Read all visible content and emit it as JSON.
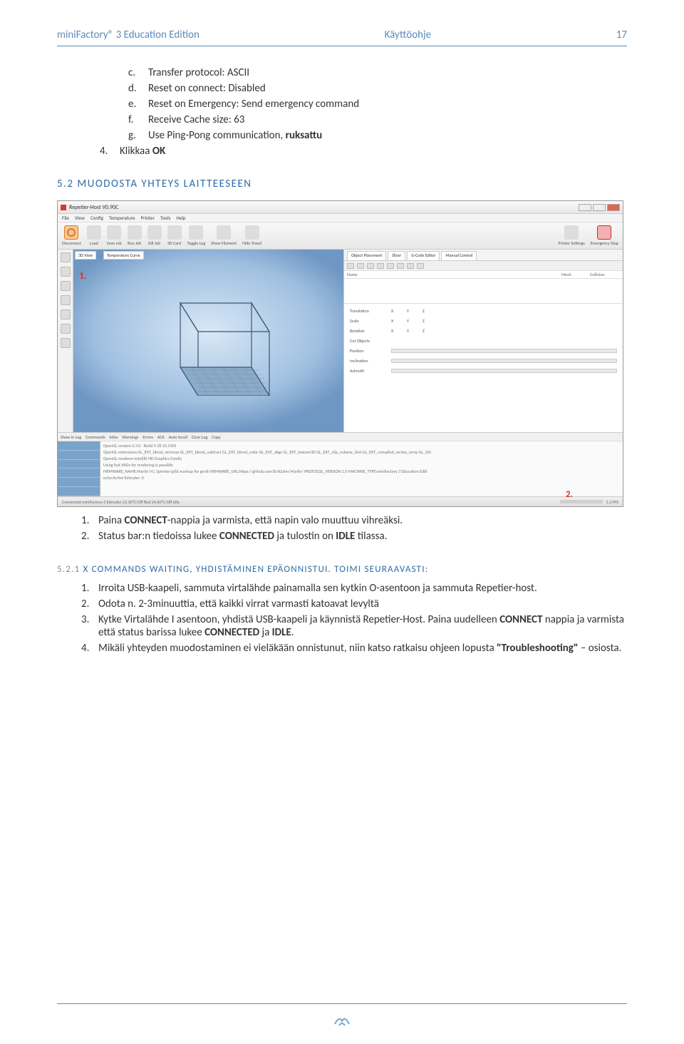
{
  "header": {
    "left": "miniFactory® 3 Education Edition",
    "center": "Käyttöohje",
    "right": "17"
  },
  "settings_list": {
    "c": {
      "label": "c.",
      "text": "Transfer protocol: ASCII"
    },
    "d": {
      "label": "d.",
      "text": "Reset on connect: Disabled"
    },
    "e": {
      "label": "e.",
      "text": "Reset on Emergency: Send emergency command"
    },
    "f": {
      "label": "f.",
      "text": "Receive Cache size: 63"
    },
    "g": {
      "label": "g.",
      "text_pre": "Use Ping-Pong communication, ",
      "text_bold": "ruksattu"
    },
    "item4": {
      "label": "4.",
      "text_pre": "Klikkaa ",
      "text_bold": "OK"
    }
  },
  "section52_title": "5.2 MUODOSTA YHTEYS LAITTEESEEN",
  "screenshot": {
    "title": "Repetier-Host V0.90C",
    "menu": [
      "File",
      "View",
      "Config",
      "Temperature",
      "Printer",
      "Tools",
      "Help"
    ],
    "toolbar_left": [
      "Disconnect",
      "Load",
      "Save Job",
      "Run Job",
      "Kill Job",
      "SD Card",
      "Toggle Log",
      "Show Filament",
      "Hide Travel"
    ],
    "toolbar_right": [
      "Printer Settings",
      "Emergency Stop"
    ],
    "left_tab": "3D View",
    "temp_tab": "Temperature Curve",
    "marker1": "1.",
    "right_tabs": [
      "Object Placement",
      "Slicer",
      "G-Code Editor",
      "Manual Control"
    ],
    "table_head": [
      "Name",
      "Mesh",
      "Collision"
    ],
    "props": {
      "translation": "Translation",
      "scale": "Scale",
      "rotation": "Rotation",
      "cut": "Cut Objects",
      "position": "Position",
      "inclination": "Inclination",
      "azimuth": "Azimuth",
      "x": "X",
      "y": "Y",
      "z": "Z"
    },
    "logbar": [
      "Show in Log",
      "Commands",
      "Infos",
      "Warnings",
      "Errors",
      "ACK",
      "Auto Scroll",
      "Clear Log",
      "Copy"
    ],
    "log_lines": [
      "OpenGL version:3.3.0 - Build 9.18.10.3165",
      "OpenGL extensions:GL_EXT_blend_minmax GL_EXT_blend_subtract GL_EXT_blend_color GL_EXT_abgr GL_EXT_texture3D GL_EXT_clip_volume_hint GL_EXT_compiled_vertex_array GL_SGI",
      "OpenGL renderer:Intel(R) HD Graphics Family",
      "Using fast VAOs for rendering is possible",
      "FIRMWARE_NAME:Marlin V1; Sprinter/grbl mashup for gen6 FIRMWARE_URL:https://github.com/ErikZalm/Marlin/ PROTOCOL_VERSION:1.0 MACHINE_TYPE:miniFactory 3 Education Editi",
      "echo:Active Extruder: 0"
    ],
    "marker2": "2.",
    "status_left": "Connected:miniFactory-3  Extruder 22.30°C/Off Bed 24.60°C/Off  Idle",
    "status_fps": "1.2 FPS"
  },
  "after_ss_list": {
    "1": {
      "n": "1.",
      "pre": "Paina ",
      "b1": "CONNECT",
      "mid": "-nappia ja varmista, että napin valo muuttuu vihreäksi."
    },
    "2": {
      "n": "2.",
      "pre": "Status bar:n tiedoissa lukee ",
      "b1": "CONNECTED",
      "mid": " ja tulostin on ",
      "b2": "IDLE",
      "post": " tilassa."
    }
  },
  "sub_521": {
    "num": "5.2.1",
    "title": "X COMMANDS WAITING, YHDISTÄMINEN EPÄONNISTUI.",
    "title2": "TOIMI SEURAAVASTI:"
  },
  "list_521": {
    "1": {
      "n": "1.",
      "t": "Irroita USB-kaapeli, sammuta virtalähde painamalla sen kytkin O-asentoon ja sammuta Repetier-host."
    },
    "2": {
      "n": "2.",
      "t": "Odota n. 2-3minuuttia, että kaikki virrat varmasti katoavat levyltä"
    },
    "3": {
      "n": "3.",
      "pre": "Kytke Virtalähde I asentoon, yhdistä USB-kaapeli ja käynnistä Repetier-Host. Paina uudelleen ",
      "b1": "CONNECT",
      "mid": " nappia ja varmista että status barissa lukee ",
      "b2": "CONNECTED",
      "mid2": " ja ",
      "b3": "IDLE",
      "post": "."
    },
    "4": {
      "n": "4.",
      "pre": "Mikäli yhteyden muodostaminen ei vieläkään onnistunut, niin katso ratkaisu ohjeen lopusta ",
      "b1": "\"Troubleshooting\"",
      "post": " – osiosta."
    }
  }
}
